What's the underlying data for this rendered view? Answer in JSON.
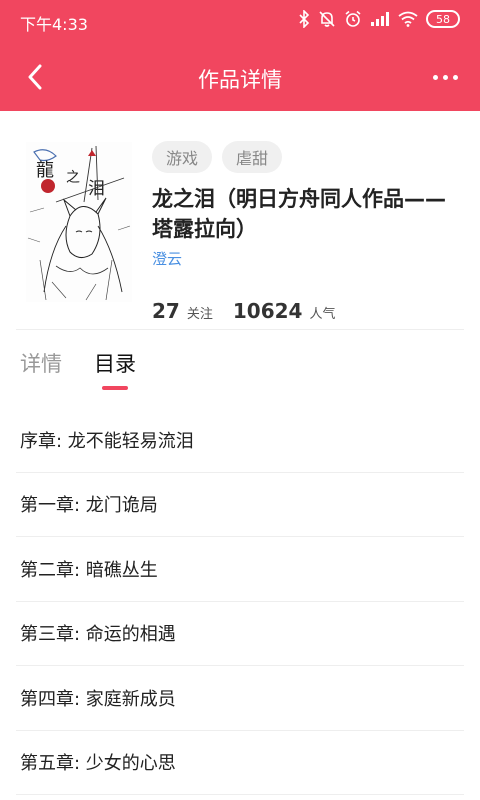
{
  "status_bar": {
    "time": "下午4:33",
    "battery_level": "58",
    "icons": [
      "bluetooth-icon",
      "mute-bell-icon",
      "alarm-icon",
      "signal-icon",
      "wifi-icon",
      "battery-icon"
    ]
  },
  "toolbar": {
    "title": "作品详情",
    "back_icon": "chevron-left-icon",
    "more_icon": "more-dots-icon"
  },
  "book": {
    "tags": [
      "游戏",
      "虐甜"
    ],
    "title": "龙之泪（明日方舟同人作品——塔露拉向）",
    "author": "澄云",
    "follow_count": "27",
    "follow_label": "关注",
    "popularity_count": "10624",
    "popularity_label": "人气"
  },
  "tabs": [
    {
      "label": "详情",
      "active": false
    },
    {
      "label": "目录",
      "active": true
    }
  ],
  "chapters": [
    "序章: 龙不能轻易流泪",
    "第一章: 龙门诡局",
    "第二章: 暗礁丛生",
    "第三章: 命运的相遇",
    "第四章: 家庭新成员",
    "第五章: 少女的心思"
  ],
  "colors": {
    "accent": "#f1465f",
    "author_link": "#4a90e2"
  }
}
